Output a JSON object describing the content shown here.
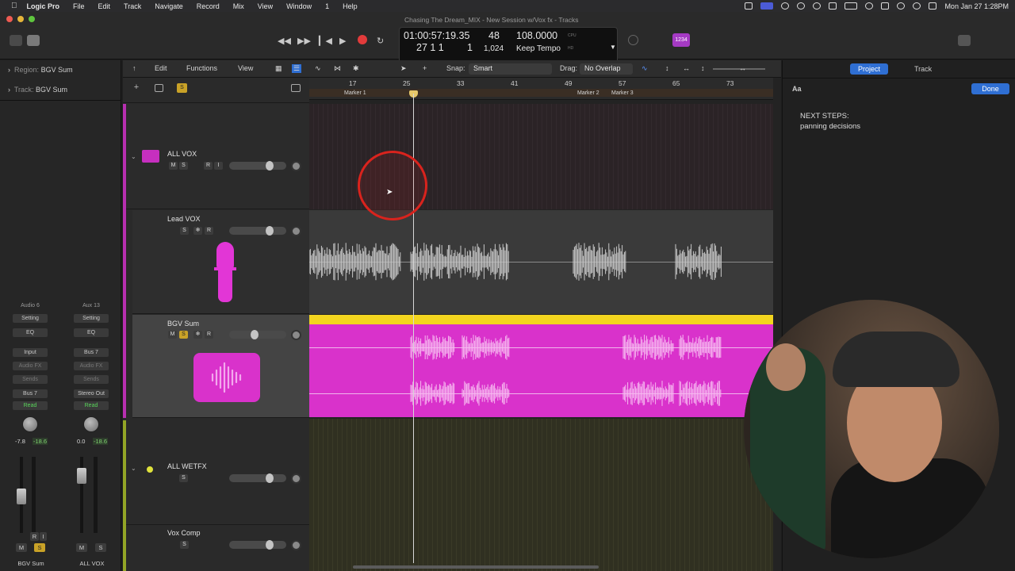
{
  "menubar": {
    "app": "Logic Pro",
    "items": [
      "File",
      "Edit",
      "Track",
      "Navigate",
      "Record",
      "Mix",
      "View",
      "Window",
      "1",
      "Help"
    ],
    "clock": "Mon Jan 27  1:28PM"
  },
  "window": {
    "title": "Chasing The Dream_MIX - New Session w/Vox fx - Tracks"
  },
  "lcd": {
    "time": "01:00:57:19.35",
    "bars": "27  1  1",
    "beat": "1",
    "tempo_sig": "48",
    "division": "1,024",
    "tempo": "108.0000",
    "tempo_mode": "Keep Tempo",
    "cpu_label": "CPU",
    "hd_label": "HD"
  },
  "badge": "1234",
  "inspector": {
    "region_key": "Region:",
    "region_val": "BGV Sum",
    "track_key": "Track:",
    "track_val": "BGV Sum",
    "strips": [
      {
        "name_top": "Audio 6",
        "setting": "Setting",
        "eq": "EQ",
        "input": "Input",
        "audio_fx": "Audio FX",
        "sends": "Sends",
        "output": "Bus 7",
        "automation": "Read",
        "vol": "-7.8",
        "peak": "-18.6",
        "btn_r": "R",
        "btn_i": "I",
        "btn_m": "M",
        "btn_s": "S",
        "name": "BGV Sum"
      },
      {
        "name_top": "Aux 13",
        "setting": "Setting",
        "eq": "EQ",
        "input": "Bus 7",
        "audio_fx": "Audio FX",
        "sends": "Sends",
        "output": "Stereo Out",
        "automation": "Read",
        "vol": "0.0",
        "peak": "-18.6",
        "btn_m": "M",
        "btn_s": "S",
        "name": "ALL VOX"
      }
    ]
  },
  "localbar": {
    "edit": "Edit",
    "functions": "Functions",
    "view": "View",
    "snap_label": "Snap:",
    "snap_value": "Smart",
    "drag_label": "Drag:",
    "drag_value": "No Overlap"
  },
  "ruler": {
    "bars": [
      "17",
      "25",
      "33",
      "41",
      "49",
      "57",
      "65",
      "73"
    ],
    "markers": [
      "Marker 1",
      "Marker 2",
      "Marker 3"
    ]
  },
  "tracks": [
    {
      "name": "ALL VOX",
      "buttons": [
        "M",
        "S",
        "R",
        "I"
      ],
      "color": "#c62fbf"
    },
    {
      "name": "Lead VOX",
      "buttons": [
        "S",
        "❄",
        "R"
      ],
      "color": "#e236d6"
    },
    {
      "name": "BGV Sum",
      "buttons": [
        "M",
        "S",
        "❄",
        "R"
      ],
      "color": "#d32fc9"
    },
    {
      "name": "ALL WETFX",
      "buttons": [
        "S"
      ],
      "color": "#b7c42a"
    },
    {
      "name": "Vox Comp",
      "buttons": [
        "S"
      ],
      "color": "#b7c42a"
    }
  ],
  "header_tools": {
    "add": "+",
    "solo": "S"
  },
  "notes": {
    "tab_project": "Project",
    "tab_track": "Track",
    "font_btn": "Aa",
    "done": "Done",
    "heading": "NEXT STEPS:",
    "body": "panning decisions"
  },
  "colors": {
    "track_magenta": "#d932cb",
    "region_yellow": "#f3d51f",
    "fx_green": "#a6b52a",
    "accent_blue": "#2f6fd3"
  }
}
